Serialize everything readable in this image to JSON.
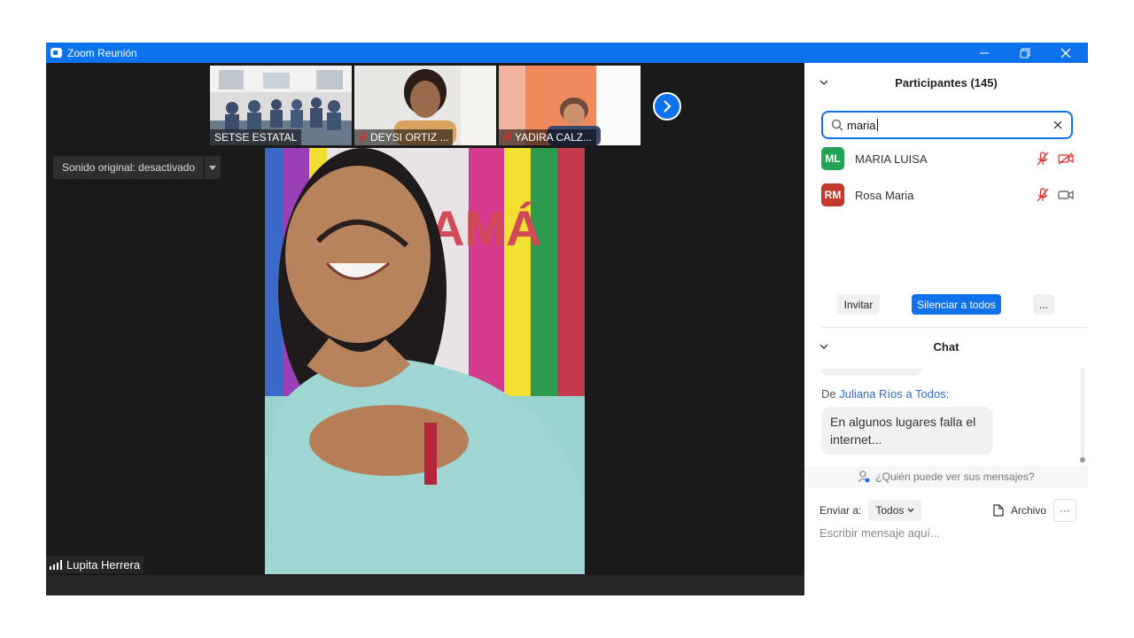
{
  "window": {
    "title": "Zoom Reunión"
  },
  "thumbnails": [
    {
      "name": "SETSE ESTATAL",
      "muted": false
    },
    {
      "name": "DEYSI ORTIZ ...",
      "muted": true
    },
    {
      "name": "YADIRA CALZ...",
      "muted": true
    }
  ],
  "audio": {
    "dropdown_label": "Sonido original: desactivado"
  },
  "speaker": {
    "name": "Lupita Herrera"
  },
  "participants": {
    "title": "Participantes (145)",
    "search_value": "maria",
    "list": [
      {
        "initials": "ML",
        "name": "MARIA LUISA",
        "color": "#23a355"
      },
      {
        "initials": "RM",
        "name": "Rosa Maria",
        "color": "#c23a2f"
      }
    ],
    "invite_label": "Invitar",
    "mute_all_label": "Silenciar a todos",
    "more_label": "..."
  },
  "chat": {
    "title": "Chat",
    "from_prefix": "De",
    "from_sender": "Juliana Ríos",
    "from_to": "a",
    "from_recipient": "Todos",
    "from_colon": ":",
    "message": "En algunos lugares falla el internet...",
    "who_can_see": "¿Quién puede ver sus mensajes?",
    "send_to_label": "Enviar a:",
    "send_to_value": "Todos",
    "file_label": "Archivo",
    "more_label": "···",
    "input_placeholder": "Escribir mensaje aquí..."
  },
  "colors": {
    "accent": "#0e72ed",
    "muted_red": "#e02828"
  }
}
